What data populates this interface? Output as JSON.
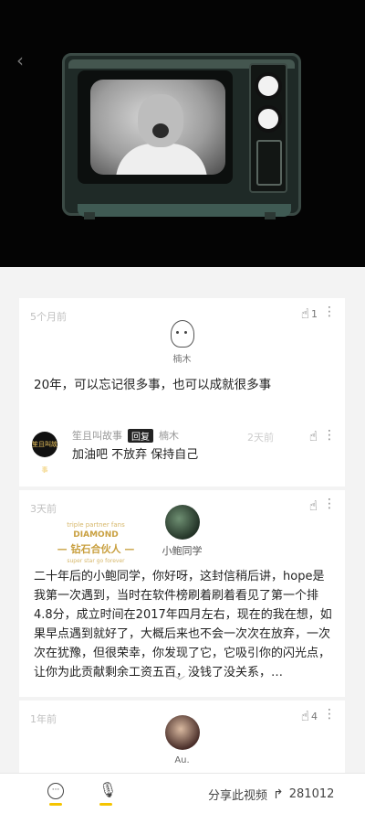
{
  "video": {
    "back_icon": "chevron-left-icon"
  },
  "comments": [
    {
      "time": "5个月前",
      "likes": "1",
      "author": "楠木",
      "text": "20年，可以忘记很多事，也可以成就很多事",
      "reply": {
        "avatar_text": "笙且叫故事",
        "author": "笙且叫故事",
        "tag": "回复",
        "to": "楠木",
        "text": "加油吧 不放弃 保持自己",
        "time": "2天前"
      }
    },
    {
      "time": "3天前",
      "badge": {
        "line1": "triple partner fans",
        "line2": "DIAMOND",
        "line3": "— 钻石合伙人 —",
        "line4": "super star go forever"
      },
      "author": "小鲍同学",
      "text": "二十年后的小鲍同学，你好呀，这封信稍后讲，hope是我第一次遇到，当时在软件榜刷着刷着看见了第一个排4.8分，成立时间在2017年四月左右，现在的我在想，如果早点遇到就好了，大概后来也不会一次次在放弃，一次次在犹豫，但很荣幸，你发现了它，它吸引你的闪光点，让你为此贡献剩余工资五百，没钱了没关系，…",
      "expand": "﹀"
    },
    {
      "time": "1年前",
      "likes": "4",
      "author": "Au."
    }
  ],
  "bottom_bar": {
    "share_label": "分享此视频",
    "share_count": "281012"
  }
}
